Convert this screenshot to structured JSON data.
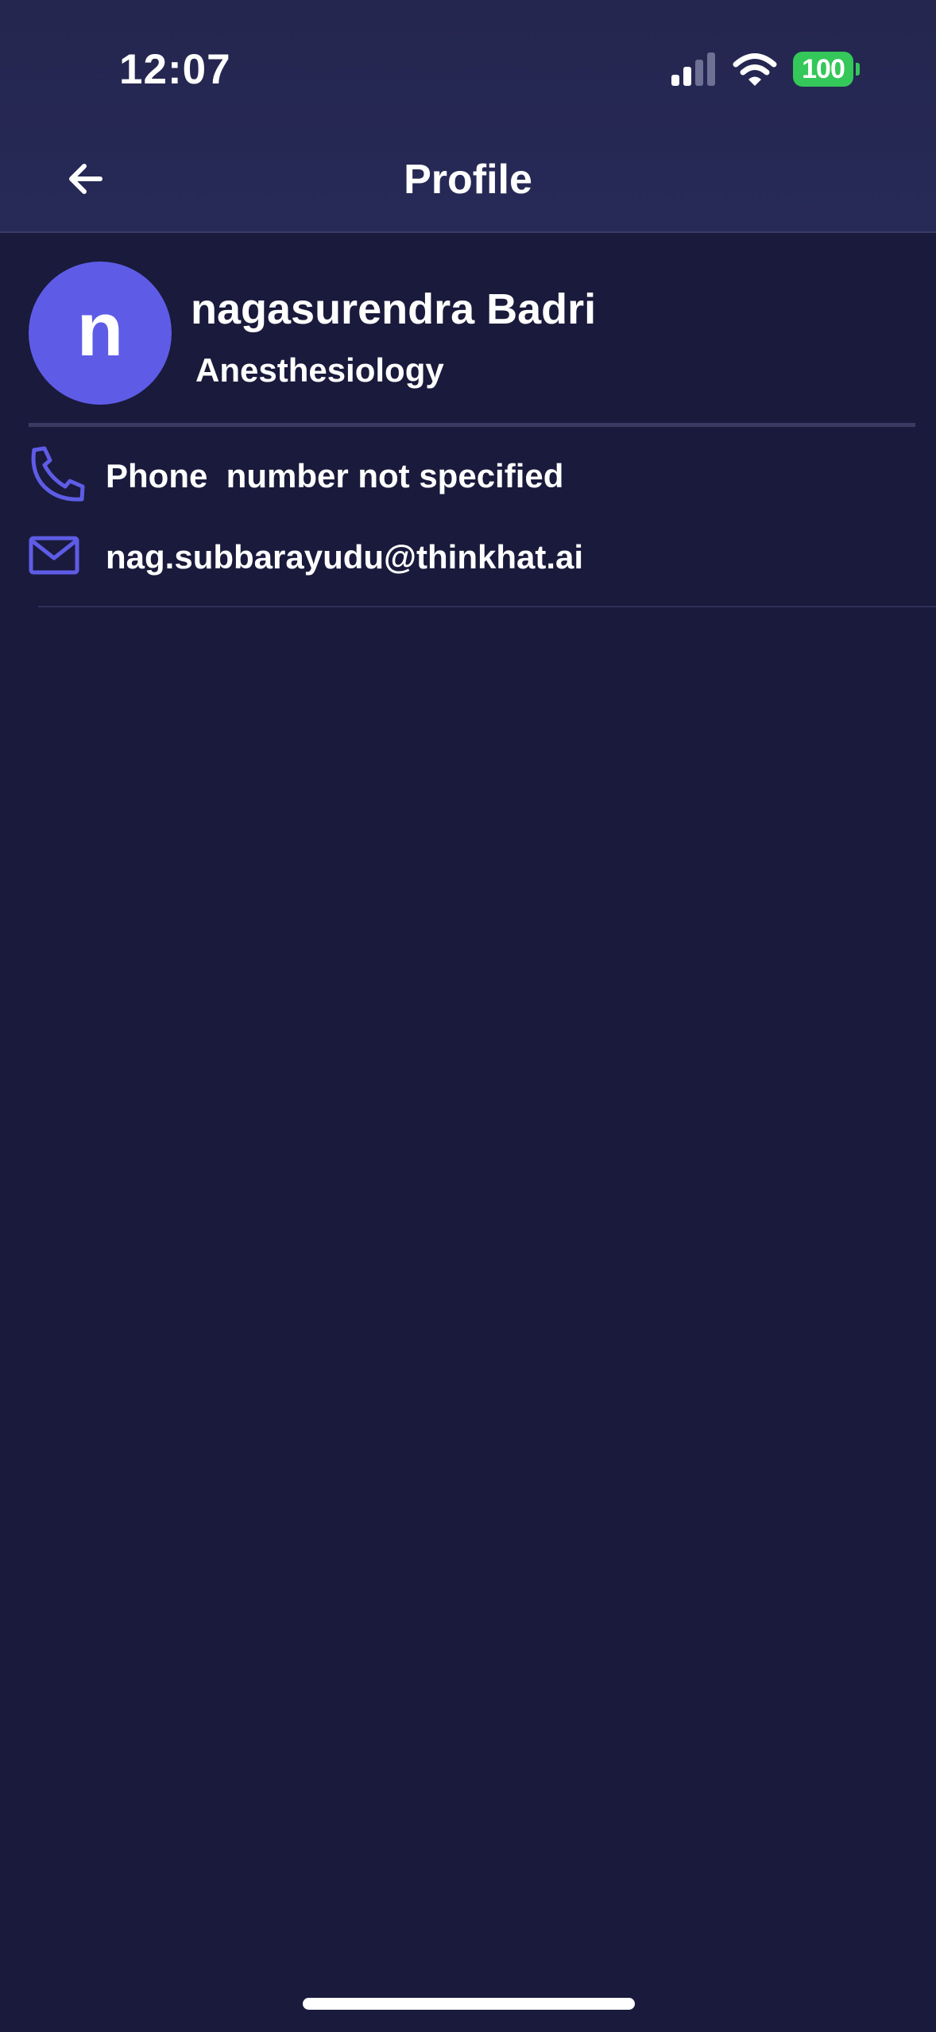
{
  "status_bar": {
    "time": "12:07",
    "battery": "100",
    "icons": [
      "signal-icon",
      "wifi-icon",
      "battery-icon"
    ]
  },
  "header": {
    "title": "Profile",
    "back_icon": "arrow-left-icon"
  },
  "profile": {
    "avatar_initial": "n",
    "name": "nagasurendra Badri",
    "specialty": "Anesthesiology"
  },
  "contact": {
    "phone_text": "Phone  number not specified",
    "phone_icon": "phone-icon",
    "email_text": "nag.subbarayudu@thinkhat.ai",
    "email_icon": "mail-icon"
  },
  "colors": {
    "background": "#1a1a3c",
    "header_background": "#262854",
    "avatar": "#5e5ce6",
    "icon_accent": "#5e5ce6",
    "battery": "#34c759"
  }
}
